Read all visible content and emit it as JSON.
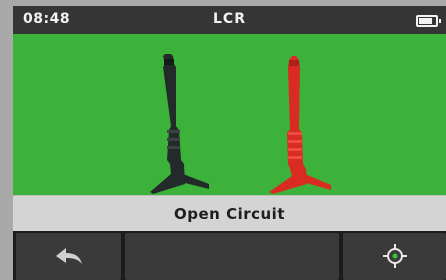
{
  "status_bar": {
    "time": "08:48",
    "mode_title": "LCR"
  },
  "status_message": "Open Circuit",
  "probes": {
    "left_color": "#222a2a",
    "right_color": "#d92b22",
    "background": "#3cb23a"
  },
  "softkeys": [
    {
      "icon": "back-arrow-icon"
    },
    {
      "icon": "blank"
    },
    {
      "icon": "crosshair-target-icon"
    }
  ]
}
